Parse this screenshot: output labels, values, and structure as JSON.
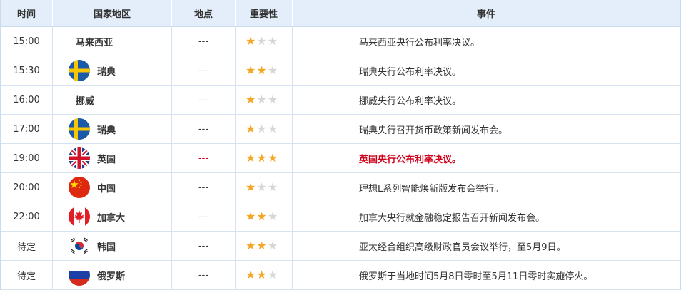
{
  "headers": {
    "time": "时间",
    "country": "国家地区",
    "place": "地点",
    "importance": "重要性",
    "event": "事件"
  },
  "colors": {
    "star_on": "#f5a623",
    "star_off": "#d6d6d6",
    "highlight": "#d0021b"
  },
  "rows": [
    {
      "time": "15:00",
      "flag": "none",
      "country": "马来西亚",
      "place": "---",
      "stars": 1,
      "event": "马来西亚央行公布利率决议。"
    },
    {
      "time": "15:30",
      "flag": "sweden-flag-icon",
      "country": "瑞典",
      "place": "---",
      "stars": 2,
      "event": "瑞典央行公布利率决议。"
    },
    {
      "time": "16:00",
      "flag": "none",
      "country": "挪威",
      "place": "---",
      "stars": 1,
      "event": "挪威央行公布利率决议。"
    },
    {
      "time": "17:00",
      "flag": "sweden-flag-icon",
      "country": "瑞典",
      "place": "---",
      "stars": 1,
      "event": "瑞典央行召开货币政策新闻发布会。"
    },
    {
      "time": "19:00",
      "flag": "uk-flag-icon",
      "country": "英国",
      "place": "---",
      "stars": 3,
      "event": "英国央行公布利率决议。",
      "highlight": true
    },
    {
      "time": "20:00",
      "flag": "china-flag-icon",
      "country": "中国",
      "place": "---",
      "stars": 1,
      "event": "理想L系列智能焕新版发布会举行。"
    },
    {
      "time": "22:00",
      "flag": "canada-flag-icon",
      "country": "加拿大",
      "place": "---",
      "stars": 2,
      "event": "加拿大央行就金融稳定报告召开新闻发布会。"
    },
    {
      "time": "待定",
      "flag": "korea-flag-icon",
      "country": "韩国",
      "place": "---",
      "stars": 2,
      "event": "亚太经合组织高级财政官员会议举行，至5月9日。"
    },
    {
      "time": "待定",
      "flag": "russia-flag-icon",
      "country": "俄罗斯",
      "place": "---",
      "stars": 2,
      "event": "俄罗斯于当地时间5月8日零时至5月11日零时实施停火。"
    }
  ]
}
